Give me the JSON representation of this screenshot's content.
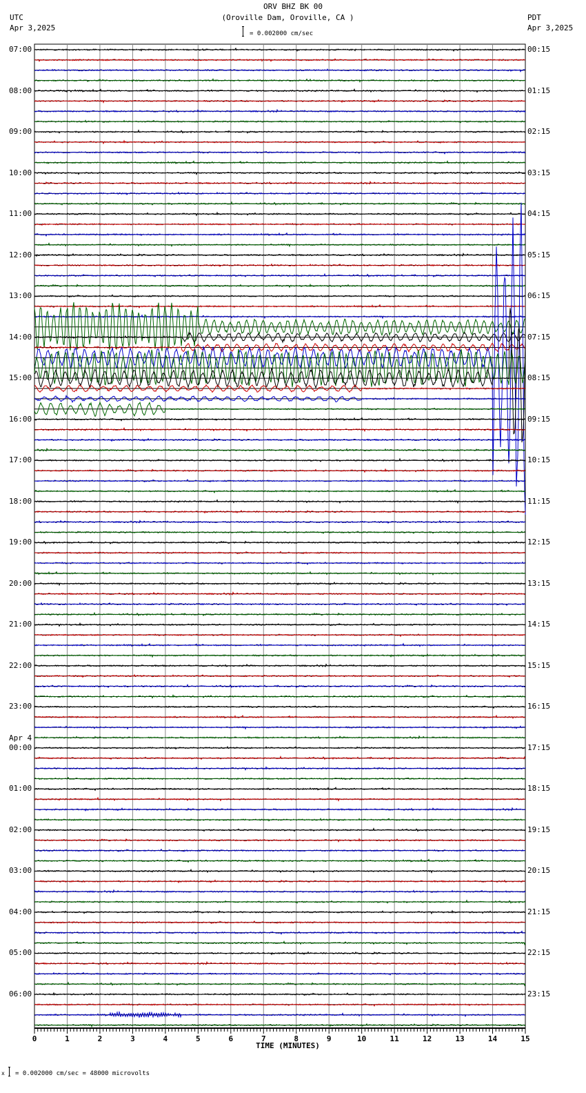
{
  "header": {
    "title": "ORV BHZ BK 00",
    "subtitle": "(Oroville Dam, Oroville, CA )",
    "left_tz": "UTC",
    "left_date": "Apr 3,2025",
    "right_tz": "PDT",
    "right_date": "Apr 3,2025",
    "scale_label": "= 0.002000 cm/sec"
  },
  "footer": {
    "scale_note": "= 0.002000 cm/sec =   48000 microvolts",
    "prefix": "x"
  },
  "chart_data": {
    "type": "line",
    "title": "ORV BHZ BK 00",
    "xlabel": "TIME (MINUTES)",
    "xlim": [
      0,
      15
    ],
    "x_ticks": [
      "0",
      "1",
      "2",
      "3",
      "4",
      "5",
      "6",
      "7",
      "8",
      "9",
      "10",
      "11",
      "12",
      "13",
      "14",
      "15"
    ],
    "traces_per_hour": 4,
    "trace_count": 96,
    "trace_colors": [
      "#000000",
      "#cc0000",
      "#0000cc",
      "#006600"
    ],
    "left_labels": [
      "07:00",
      "08:00",
      "09:00",
      "10:00",
      "11:00",
      "12:00",
      "13:00",
      "14:00",
      "15:00",
      "16:00",
      "17:00",
      "18:00",
      "19:00",
      "20:00",
      "21:00",
      "22:00",
      "23:00",
      "00:00",
      "01:00",
      "02:00",
      "03:00",
      "04:00",
      "05:00",
      "06:00"
    ],
    "date_change_label": "Apr 4",
    "right_labels": [
      "00:15",
      "01:15",
      "02:15",
      "03:15",
      "04:15",
      "05:15",
      "06:15",
      "07:15",
      "08:15",
      "09:15",
      "10:15",
      "11:15",
      "12:15",
      "13:15",
      "14:15",
      "15:15",
      "16:15",
      "17:15",
      "18:15",
      "19:15",
      "20:15",
      "21:15",
      "22:15",
      "23:15"
    ],
    "events": [
      {
        "trace": 27,
        "t0": 0,
        "t1": 5,
        "amp": 38,
        "period": 0.2
      },
      {
        "trace": 27,
        "t0": 5,
        "t1": 15,
        "amp": 12,
        "period": 0.25
      },
      {
        "trace": 31,
        "t0": 0,
        "t1": 15,
        "amp": 28,
        "period": 0.22
      },
      {
        "trace": 28,
        "t0": 4.5,
        "t1": 15,
        "amp": 7,
        "period": 0.3
      },
      {
        "trace": 29,
        "t0": 4.5,
        "t1": 15,
        "amp": 6,
        "period": 0.3
      },
      {
        "trace": 30,
        "t0": 0,
        "t1": 14,
        "amp": 16,
        "period": 0.28
      },
      {
        "trace": 30,
        "t0": 14,
        "t1": 15,
        "amp": 240,
        "period": 0.25
      },
      {
        "trace": 32,
        "t0": 0,
        "t1": 14,
        "amp": 14,
        "period": 0.3
      },
      {
        "trace": 32,
        "t0": 14.5,
        "t1": 15,
        "amp": 160,
        "period": 0.25
      },
      {
        "trace": 33,
        "t0": 0,
        "t1": 10,
        "amp": 5,
        "period": 0.35
      },
      {
        "trace": 34,
        "t0": 0,
        "t1": 10,
        "amp": 4,
        "period": 0.35
      },
      {
        "trace": 35,
        "t0": 0,
        "t1": 4,
        "amp": 10,
        "period": 0.3
      },
      {
        "trace": 94,
        "t0": 2.3,
        "t1": 4.5,
        "amp": 4,
        "period": 0.03
      }
    ]
  }
}
